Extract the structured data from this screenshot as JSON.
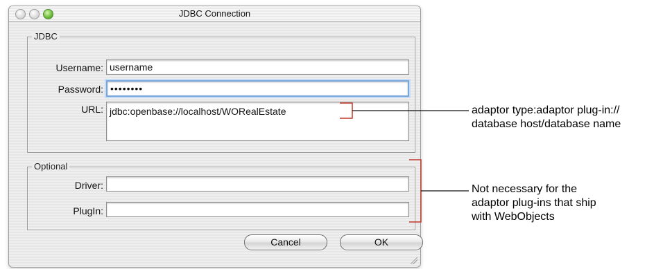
{
  "window": {
    "title": "JDBC Connection"
  },
  "jdbc_group": {
    "legend": "JDBC",
    "username_label": "Username:",
    "username_value": "username",
    "password_label": "Password:",
    "password_value": "••••••••",
    "url_label": "URL:",
    "url_value": "jdbc:openbase://localhost/WORealEstate"
  },
  "optional_group": {
    "legend": "Optional",
    "driver_label": "Driver:",
    "driver_value": "",
    "plugin_label": "PlugIn:",
    "plugin_value": ""
  },
  "buttons": {
    "cancel": "Cancel",
    "ok": "OK"
  },
  "annotations": {
    "url_note_line1": "adaptor type:adaptor plug-in://",
    "url_note_line2": "database host/database name",
    "optional_note_line1": "Not necessary for the",
    "optional_note_line2": "adaptor plug-ins that ship",
    "optional_note_line3": "with WebObjects"
  }
}
